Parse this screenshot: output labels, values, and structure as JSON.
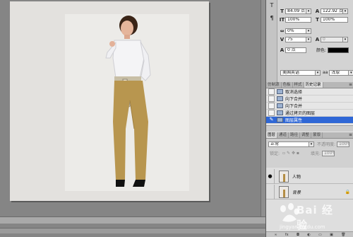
{
  "character": {
    "size_value": "84.09 点",
    "leading_value": "122.92 点",
    "vscale_value": "100%",
    "hscale_value": "100%",
    "tracking_value": "0%",
    "kerning_value": "75",
    "kerning_extra": "0",
    "baseline_value": "0 点",
    "color_label": "颜色:",
    "language_value": "美国英语",
    "aa_label": "aa",
    "aa_value": "浑厚",
    "color_swatch": "#000000"
  },
  "history": {
    "tabs": [
      "仿制源",
      "色板",
      "样式",
      "历史记录"
    ],
    "active_tab": "历史记录",
    "items": [
      "取消选择",
      "向下合并",
      "向下合并",
      "通过拷贝的图层",
      "图层属性"
    ],
    "selected_index": 4
  },
  "layers": {
    "tabs": [
      "图层",
      "通道",
      "路径",
      "调整",
      "蒙版"
    ],
    "active_tab": "图层",
    "blend_mode": "正常",
    "opacity_label": "不透明度:",
    "opacity_value": "100%",
    "lock_label": "锁定:",
    "fill_label": "填充:",
    "fill_value": "100%",
    "items": [
      {
        "name": "人物",
        "visible": true,
        "italic": false
      },
      {
        "name": "背景",
        "visible": false,
        "italic": true
      }
    ]
  },
  "watermark": {
    "brand": "Bai 经验",
    "url": "jingyan.baidu.com"
  },
  "icons": {
    "tool_1": "text-tool-icon",
    "tool_2": "paragraph-icon",
    "panel_menu": "menu-icon",
    "visibility": "eye-icon",
    "lock": "lock-icon"
  }
}
